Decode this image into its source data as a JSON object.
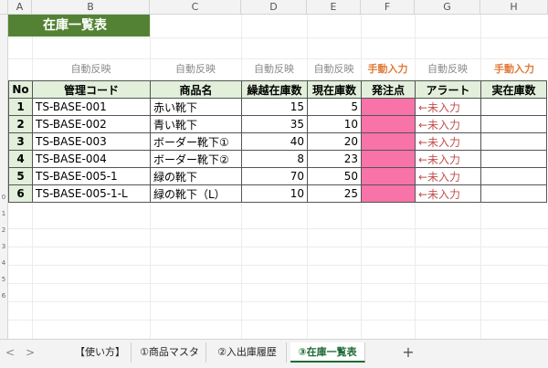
{
  "columns": [
    "A",
    "B",
    "C",
    "D",
    "E",
    "F",
    "G",
    "H"
  ],
  "sheet_title": "在庫一覧表",
  "row_labels": [
    "0",
    "1",
    "2",
    "3",
    "4",
    "5",
    "6"
  ],
  "field_labels": {
    "B": "自動反映",
    "C": "自動反映",
    "D": "自動反映",
    "E": "自動反映",
    "F": "手動入力",
    "G": "自動反映",
    "H": "手動入力"
  },
  "table": {
    "headers": [
      "No",
      "管理コード",
      "商品名",
      "繰越在庫数",
      "現在庫数",
      "発注点",
      "アラート",
      "実在庫数"
    ],
    "rows": [
      {
        "no": "1",
        "code": "TS-BASE-001",
        "name": "赤い靴下",
        "carry": "15",
        "current": "5",
        "order": "",
        "alert": "←未入力",
        "actual": ""
      },
      {
        "no": "2",
        "code": "TS-BASE-002",
        "name": "青い靴下",
        "carry": "35",
        "current": "10",
        "order": "",
        "alert": "←未入力",
        "actual": ""
      },
      {
        "no": "3",
        "code": "TS-BASE-003",
        "name": "ボーダー靴下①",
        "carry": "40",
        "current": "20",
        "order": "",
        "alert": "←未入力",
        "actual": ""
      },
      {
        "no": "4",
        "code": "TS-BASE-004",
        "name": "ボーダー靴下②",
        "carry": "8",
        "current": "23",
        "order": "",
        "alert": "←未入力",
        "actual": ""
      },
      {
        "no": "5",
        "code": "TS-BASE-005-1",
        "name": "緑の靴下",
        "carry": "70",
        "current": "50",
        "order": "",
        "alert": "←未入力",
        "actual": ""
      },
      {
        "no": "6",
        "code": "TS-BASE-005-1-L",
        "name": "緑の靴下（L）",
        "carry": "10",
        "current": "25",
        "order": "",
        "alert": "←未入力",
        "actual": ""
      }
    ]
  },
  "tabs": {
    "nav_prev": "<",
    "nav_next": ">",
    "items": [
      "【使い方】",
      "①商品マスタ",
      "②入出庫履歴",
      "③在庫一覧表"
    ],
    "active": "③在庫一覧表",
    "add": "+"
  },
  "colors": {
    "title_bg": "#548235",
    "header_bg": "#e2efda",
    "order_fill": "#f773a8",
    "alert_text": "#c0504d",
    "manual_label": "#e07b39"
  }
}
